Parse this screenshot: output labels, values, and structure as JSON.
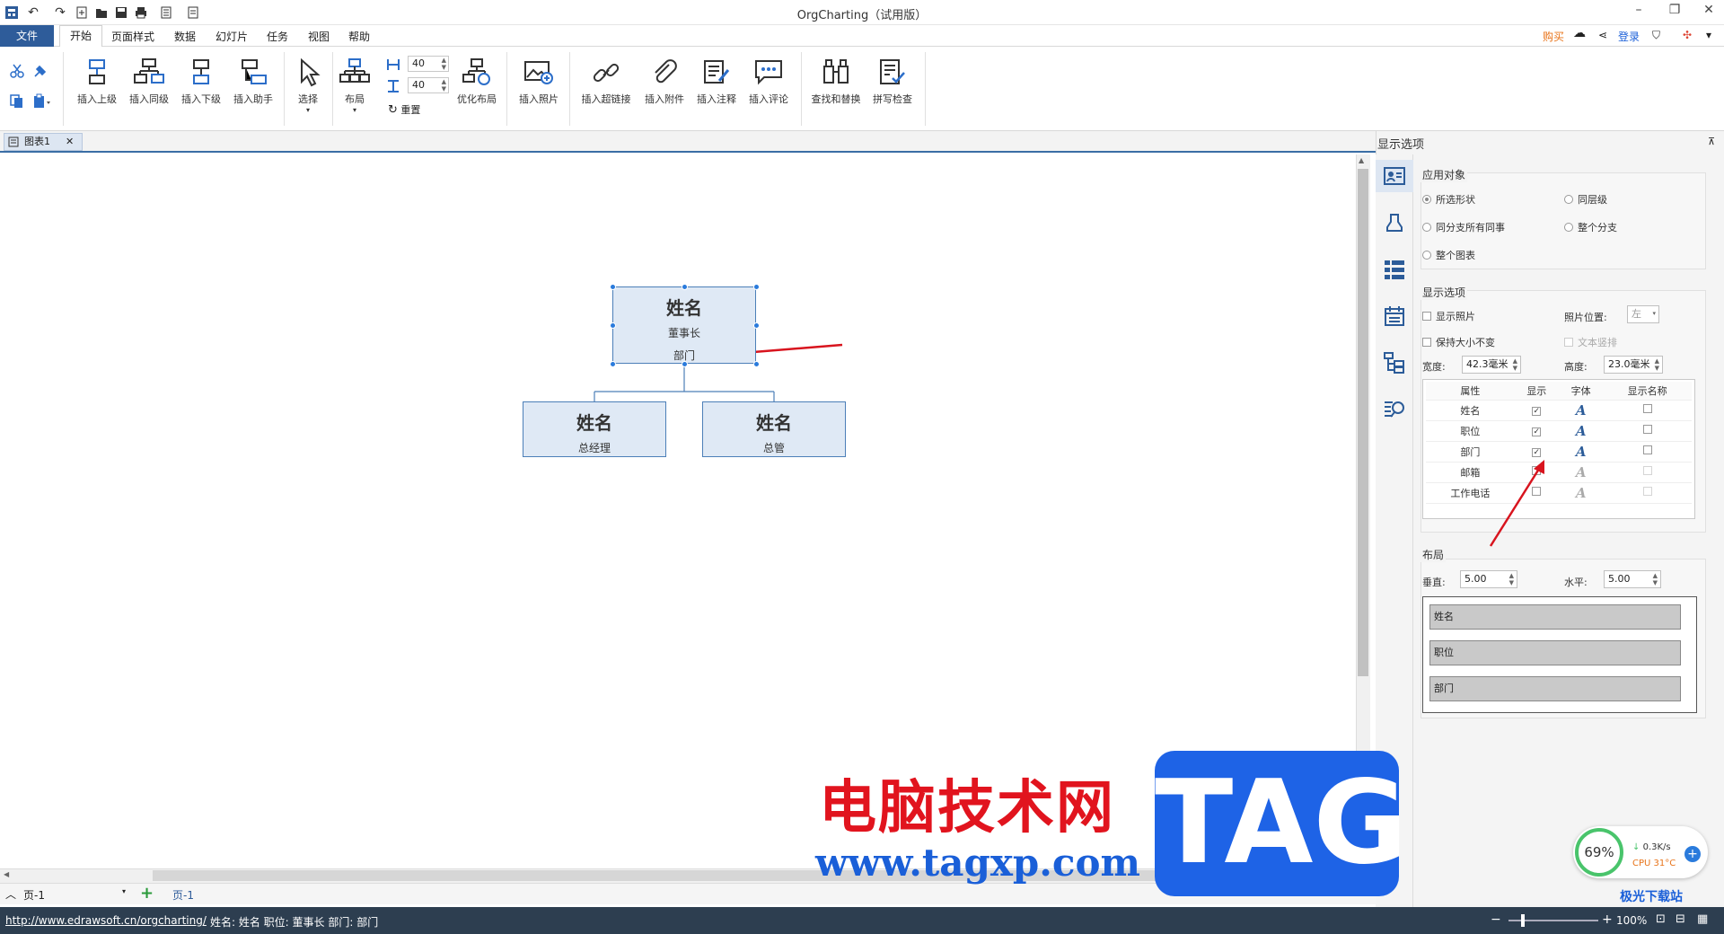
{
  "app": {
    "title": "OrgCharting（试用版）"
  },
  "menu": {
    "file": "文件",
    "tabs": [
      "开始",
      "页面样式",
      "数据",
      "幻灯片",
      "任务",
      "视图",
      "帮助"
    ]
  },
  "topright": {
    "buy": "购买",
    "login": "登录"
  },
  "ribbon": {
    "insert_superior": "插入上级",
    "insert_peer": "插入同级",
    "insert_sub": "插入下级",
    "insert_assistant": "插入助手",
    "select": "选择",
    "layout": "布局",
    "spacing_h": "40",
    "spacing_v": "40",
    "reset": "重置",
    "optimize": "优化布局",
    "insert_photo": "插入照片",
    "insert_link": "插入超链接",
    "insert_attachment": "插入附件",
    "insert_note": "插入注释",
    "insert_comment": "插入评论",
    "find_replace": "查找和替换",
    "spellcheck": "拼写检查"
  },
  "doc_tab": "图表1",
  "chart": {
    "root": {
      "name": "姓名",
      "title": "董事长",
      "dept": "部门"
    },
    "children": [
      {
        "name": "姓名",
        "title": "总经理"
      },
      {
        "name": "姓名",
        "title": "总管"
      }
    ]
  },
  "panel": {
    "title": "显示选项",
    "apply": {
      "title": "应用对象",
      "options": [
        "所选形状",
        "同层级",
        "同分支所有同事",
        "整个分支",
        "整个图表"
      ],
      "selected": "所选形状"
    },
    "display": {
      "title": "显示选项",
      "show_photo": "显示照片",
      "photo_pos_label": "照片位置:",
      "photo_pos": "左",
      "keep_size": "保持大小不变",
      "vertical_text": "文本竖排",
      "width_label": "宽度:",
      "width": "42.3毫米",
      "height_label": "高度:",
      "height": "23.0毫米",
      "headers": [
        "属性",
        "显示",
        "字体",
        "显示名称"
      ],
      "rows": [
        {
          "attr": "姓名",
          "show": true
        },
        {
          "attr": "职位",
          "show": true
        },
        {
          "attr": "部门",
          "show": true
        },
        {
          "attr": "邮箱",
          "show": false
        },
        {
          "attr": "工作电话",
          "show": false
        }
      ]
    },
    "layout": {
      "title": "布局",
      "vertical_label": "垂直:",
      "vertical": "5.00",
      "horizontal_label": "水平:",
      "horizontal": "5.00",
      "order": [
        "姓名",
        "职位",
        "部门"
      ]
    }
  },
  "pagebar": {
    "page_select": "页-1",
    "page_tab": "页-1"
  },
  "status": {
    "url": "http://www.edrawsoft.cn/orgcharting/",
    "info": "姓名: 姓名  职位: 董事长  部门: 部门",
    "zoom": "100%"
  },
  "watermark": {
    "cn": "电脑技术网",
    "url": "www.tagxp.com",
    "tag": "TAG",
    "site": "极光下载站"
  },
  "cpu": {
    "percent": "69%",
    "speed": "0.3K/s",
    "temp": "CPU 31°C"
  },
  "colors": {
    "accent": "#2e5c9a",
    "node_fill": "#dfe9f5",
    "node_border": "#4c7fb8",
    "arrow": "#d8141e"
  }
}
